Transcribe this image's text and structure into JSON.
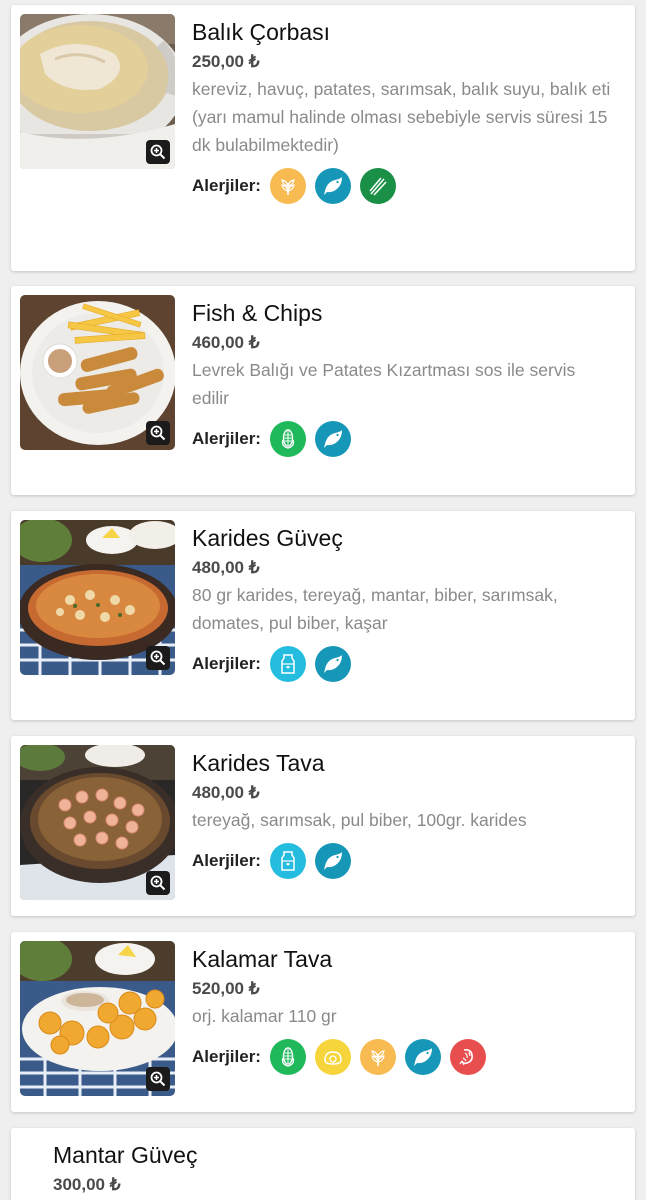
{
  "allergy_label": "Alerjiler:",
  "allergen_colors": {
    "wheat": "#f7bb52",
    "fish": "#1797b8",
    "celery": "#1a8f46",
    "corn": "#1fb85a",
    "milk": "#24bde0",
    "egg": "#f6d43c",
    "crustacean": "#e94e4e"
  },
  "menu": [
    {
      "title": "Balık Çorbası",
      "price": "250,00 ₺",
      "desc": "kereviz, havuç, patates, sarımsak, balık suyu, balık eti",
      "desc2": "(yarı mamul halinde olması sebebiyle servis süresi 15 dk bulabilmektedir)",
      "allergens": [
        "wheat-icon",
        "fish-icon",
        "celery-icon"
      ]
    },
    {
      "title": "Fish & Chips",
      "price": "460,00 ₺",
      "desc": "Levrek Balığı ve Patates Kızartması sos ile servis edilir",
      "allergens": [
        "corn-icon",
        "fish-icon"
      ]
    },
    {
      "title": "Karides Güveç",
      "price": "480,00 ₺",
      "desc": "80 gr karides, tereyağ, mantar, biber, sarımsak, domates, pul biber, kaşar",
      "allergens": [
        "milk-icon",
        "fish-icon"
      ]
    },
    {
      "title": "Karides Tava",
      "price": "480,00 ₺",
      "desc": "tereyağ, sarımsak, pul biber, 100gr. karides",
      "allergens": [
        "milk-icon",
        "fish-icon"
      ]
    },
    {
      "title": "Kalamar Tava",
      "price": "520,00 ₺",
      "desc": "orj. kalamar 110 gr",
      "allergens": [
        "corn-icon",
        "egg-icon",
        "wheat-icon",
        "fish-icon",
        "crustacean-icon"
      ]
    },
    {
      "title": "Mantar Güveç",
      "price": "300,00 ₺"
    }
  ]
}
